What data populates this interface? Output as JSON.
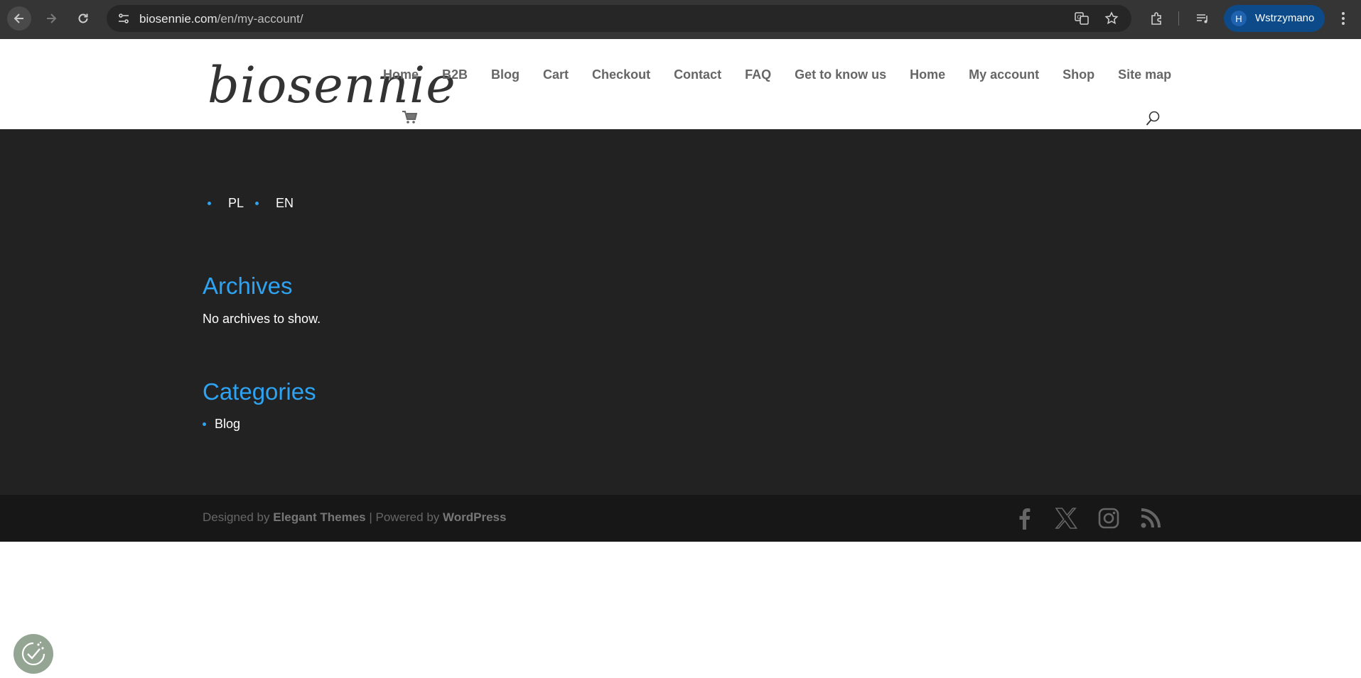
{
  "browser": {
    "url_domain": "biosennie.com",
    "url_path": "/en/my-account/",
    "profile_initial": "H",
    "profile_label": "Wstrzymano"
  },
  "site": {
    "logo_text": "biosennie",
    "nav": [
      "Home",
      "B2B",
      "Blog",
      "Cart",
      "Checkout",
      "Contact",
      "FAQ",
      "Get to know us",
      "Home",
      "My account",
      "Shop",
      "Site map"
    ]
  },
  "widgets": {
    "languages": [
      "PL",
      "EN"
    ],
    "archives_title": "Archives",
    "archives_text": "No archives to show.",
    "categories_title": "Categories",
    "categories": [
      "Blog"
    ]
  },
  "footer": {
    "designed_by": "Designed by",
    "theme_name": "Elegant Themes",
    "separator": "| Powered by",
    "platform_name": "WordPress"
  },
  "colors": {
    "accent": "#2ea3f2",
    "widget_bg": "#222222",
    "footer_bg": "#171717",
    "nav_text": "#666666"
  }
}
